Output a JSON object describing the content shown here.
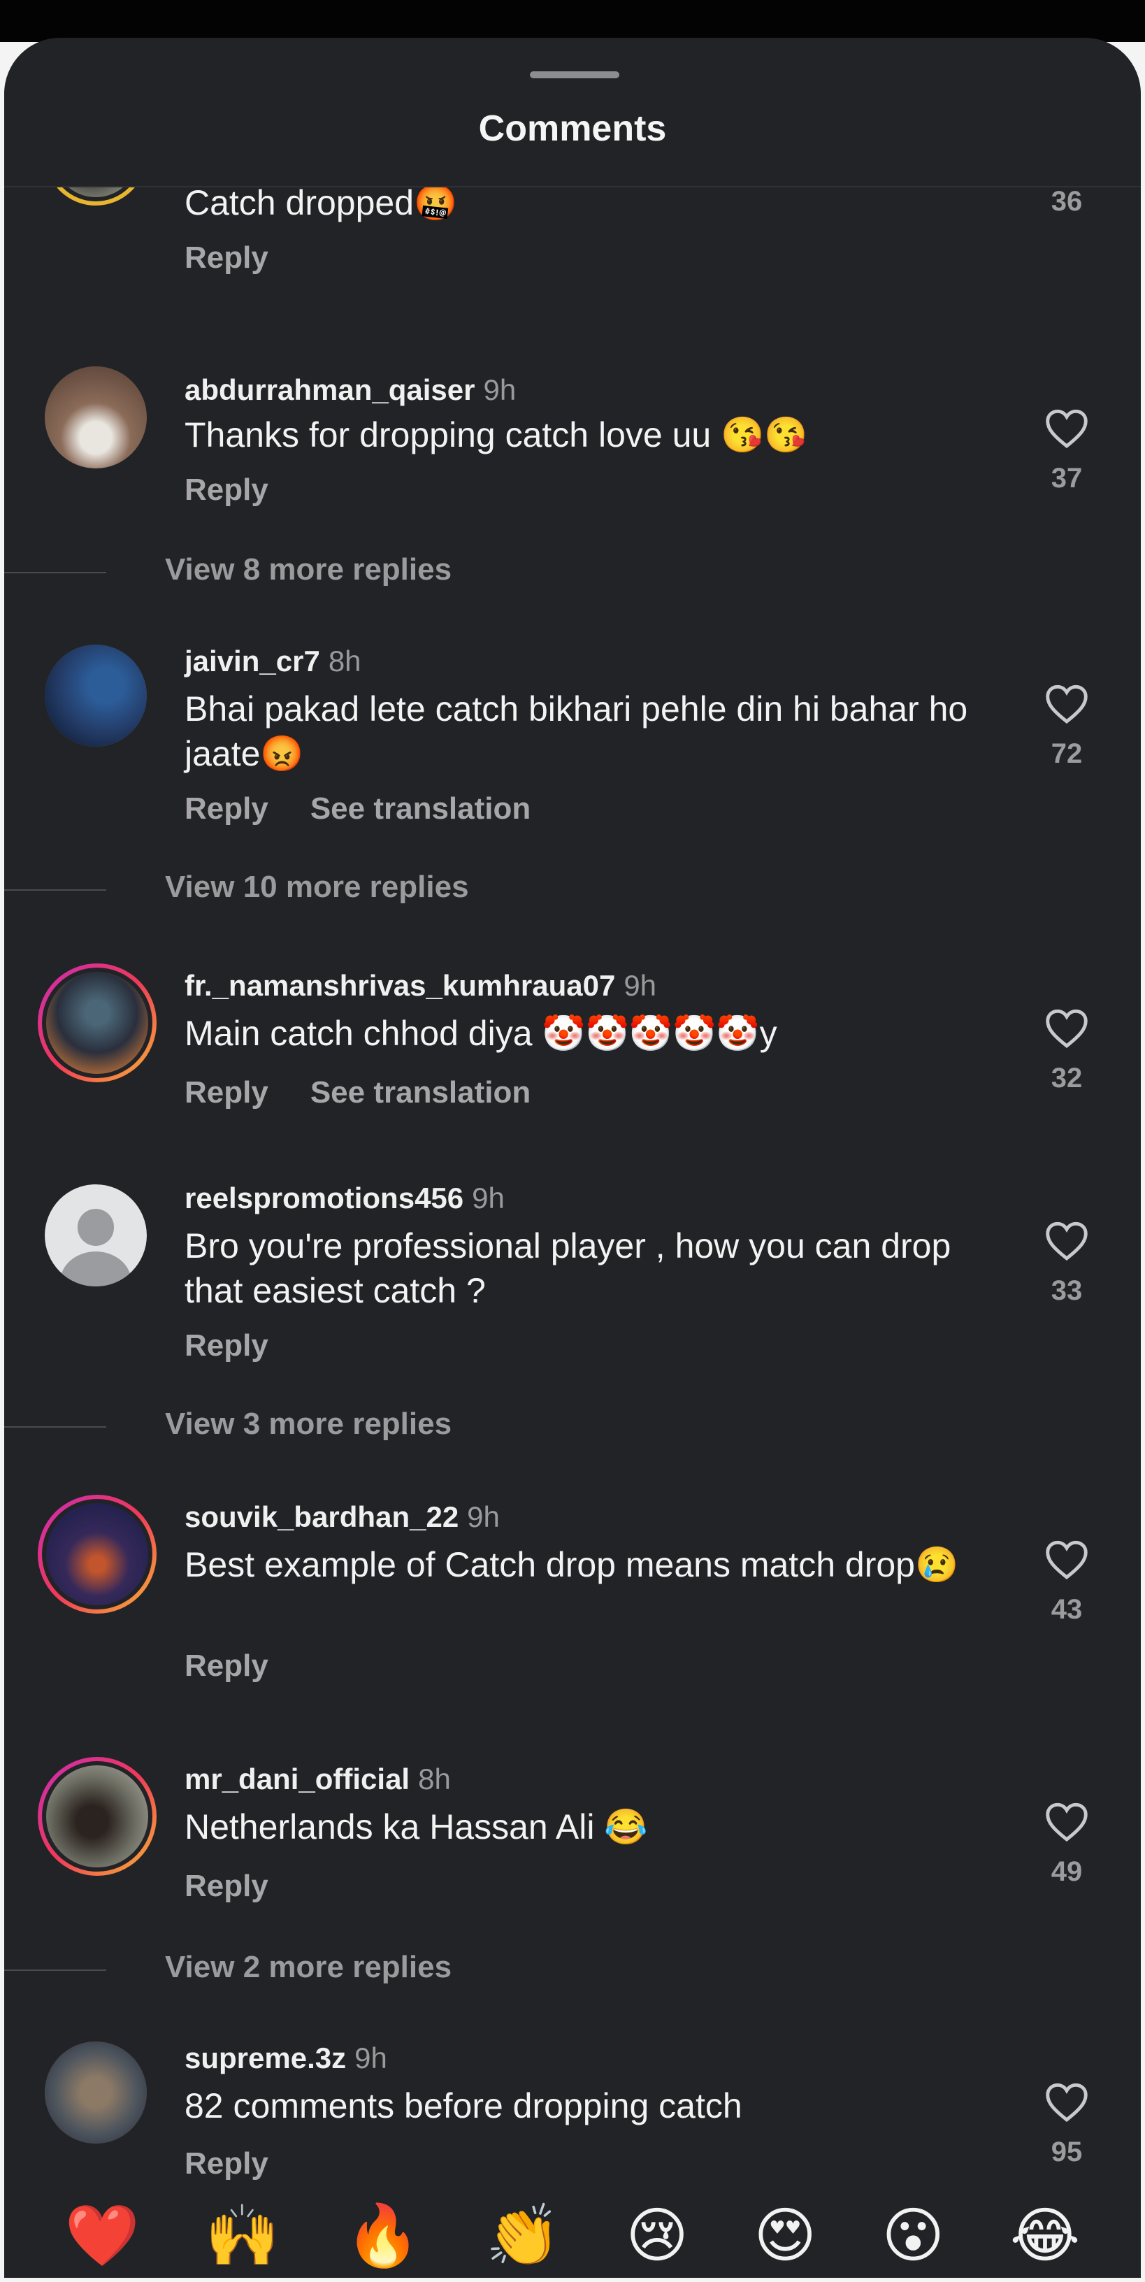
{
  "sheet": {
    "title": "Comments"
  },
  "comments": [
    {
      "username": "",
      "time": "",
      "text": "Catch dropped🤬",
      "actions": [
        "Reply"
      ],
      "likes": "36"
    },
    {
      "username": "abdurrahman_qaiser",
      "time": "9h",
      "text": "Thanks for dropping catch love uu 😘😘",
      "actions": [
        "Reply"
      ],
      "likes": "37",
      "view_more": "View 8 more replies"
    },
    {
      "username": "jaivin_cr7",
      "time": "8h",
      "text": "Bhai pakad lete catch bikhari pehle din hi bahar ho jaate😡",
      "actions": [
        "Reply",
        "See translation"
      ],
      "likes": "72",
      "view_more": "View 10 more replies"
    },
    {
      "username": "fr._namanshrivas_kumhraua07",
      "time": "9h",
      "text": "Main catch chhod diya 🤡🤡🤡🤡🤡y",
      "actions": [
        "Reply",
        "See translation"
      ],
      "likes": "32"
    },
    {
      "username": "reelspromotions456",
      "time": "9h",
      "text": "Bro you're professional player , how you can drop that easiest catch ?",
      "actions": [
        "Reply"
      ],
      "likes": "33",
      "view_more": "View 3 more replies"
    },
    {
      "username": "souvik_bardhan_22",
      "time": "9h",
      "text": "Best example of Catch drop means match drop😢",
      "actions": [
        "Reply"
      ],
      "likes": "43"
    },
    {
      "username": "mr_dani_official",
      "time": "8h",
      "text": "Netherlands ka Hassan Ali 😂",
      "actions": [
        "Reply"
      ],
      "likes": "49",
      "view_more": "View 2 more replies"
    },
    {
      "username": "supreme.3z",
      "time": "9h",
      "text": "82 comments before dropping catch",
      "actions": [
        "Reply"
      ],
      "likes": "95"
    }
  ],
  "reactions": [
    "❤️",
    "🙌",
    "🔥",
    "👏",
    "😢",
    "😍",
    "😮",
    "😂"
  ],
  "icons": {
    "like": "heart-outline-icon"
  }
}
